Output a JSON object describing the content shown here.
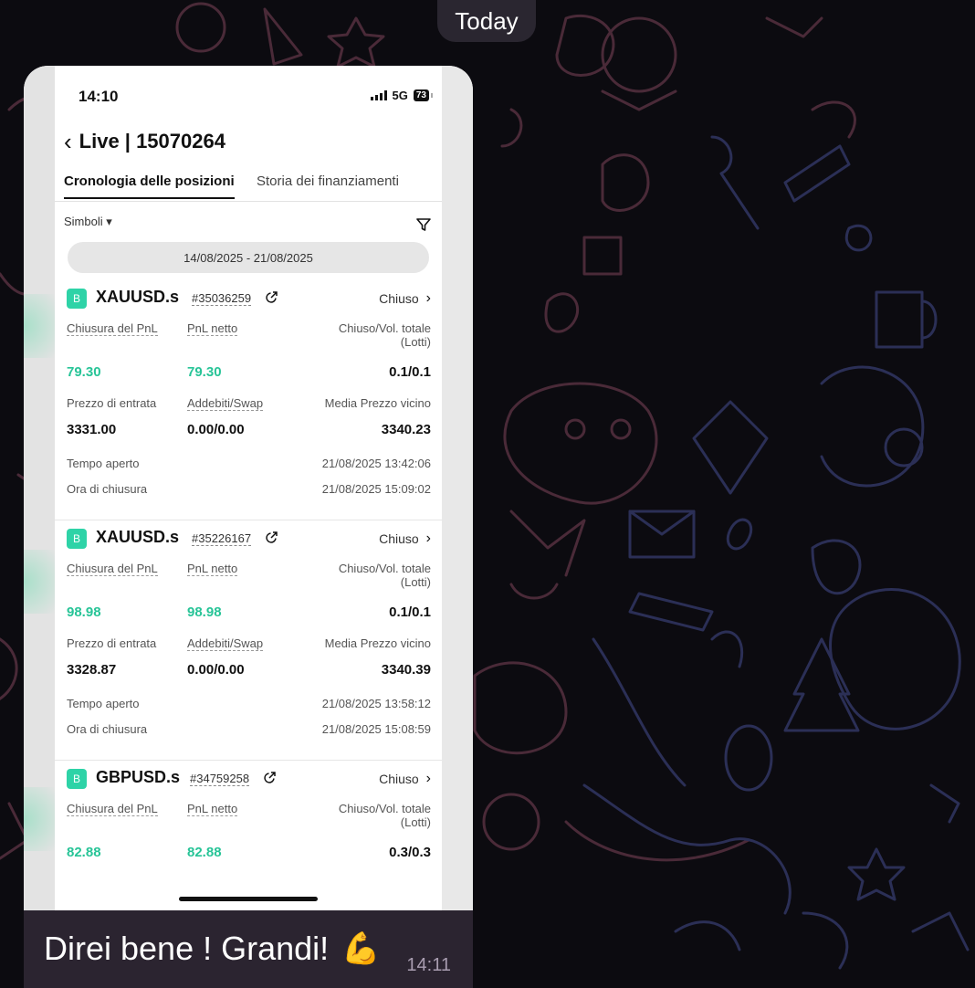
{
  "chat": {
    "date_label": "Today",
    "message": {
      "text": "Direi bene ! Grandi!",
      "emoji": "💪",
      "time": "14:11"
    }
  },
  "screenshot": {
    "status_bar": {
      "time": "14:10",
      "network": "5G",
      "battery": "73"
    },
    "nav": {
      "back_icon": "chevron-left-icon",
      "title": "Live | 15070264"
    },
    "tabs": [
      {
        "label": "Cronologia delle posizioni",
        "active": true
      },
      {
        "label": "Storia dei finanziamenti",
        "active": false
      }
    ],
    "filter": {
      "symbols_label": "Simboli ▾",
      "filter_icon": "funnel-icon"
    },
    "date_range": "14/08/2025 - 21/08/2025",
    "positions": [
      {
        "side": "B",
        "symbol": "XAUUSD.s",
        "order_id": "#35036259",
        "status": "Chiuso",
        "labels": {
          "pnl_close": "Chiusura del PnL",
          "pnl_net": "PnL netto",
          "vol": "Chiuso/Vol. totale",
          "vol_unit": "(Lotti)",
          "entry": "Prezzo di entrata",
          "fees": "Addebiti/Swap",
          "avg_close": "Media Prezzo vicino",
          "open_time": "Tempo aperto",
          "close_time": "Ora di chiusura"
        },
        "pnl_close": "79.30",
        "pnl_net": "79.30",
        "vol": "0.1/0.1",
        "entry": "3331.00",
        "fees": "0.00/0.00",
        "avg_close": "3340.23",
        "open_time": "21/08/2025 13:42:06",
        "close_time": "21/08/2025 15:09:02"
      },
      {
        "side": "B",
        "symbol": "XAUUSD.s",
        "order_id": "#35226167",
        "status": "Chiuso",
        "labels": {
          "pnl_close": "Chiusura del PnL",
          "pnl_net": "PnL netto",
          "vol": "Chiuso/Vol. totale",
          "vol_unit": "(Lotti)",
          "entry": "Prezzo di entrata",
          "fees": "Addebiti/Swap",
          "avg_close": "Media Prezzo vicino",
          "open_time": "Tempo aperto",
          "close_time": "Ora di chiusura"
        },
        "pnl_close": "98.98",
        "pnl_net": "98.98",
        "vol": "0.1/0.1",
        "entry": "3328.87",
        "fees": "0.00/0.00",
        "avg_close": "3340.39",
        "open_time": "21/08/2025 13:58:12",
        "close_time": "21/08/2025 15:08:59"
      },
      {
        "side": "B",
        "symbol": "GBPUSD.s",
        "order_id": "#34759258",
        "status": "Chiuso",
        "labels": {
          "pnl_close": "Chiusura del PnL",
          "pnl_net": "PnL netto",
          "vol": "Chiuso/Vol. totale",
          "vol_unit": "(Lotti)"
        },
        "pnl_close": "82.88",
        "pnl_net": "82.88",
        "vol": "0.3/0.3"
      }
    ],
    "colors": {
      "profit_green": "#27c497",
      "badge_green": "#2ed3a7",
      "chat_bubble": "#2b2430"
    }
  }
}
